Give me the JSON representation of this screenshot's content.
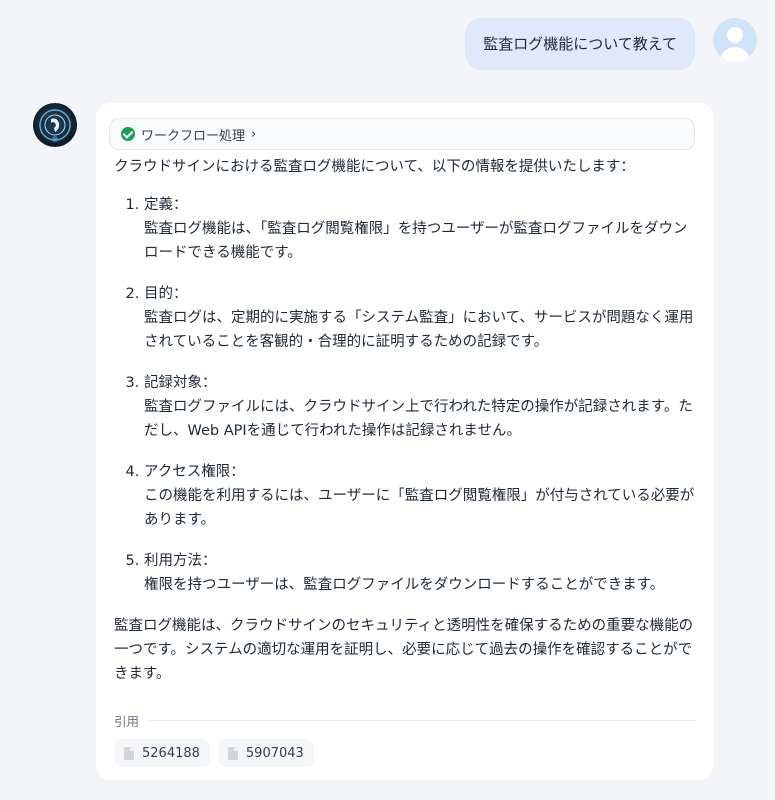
{
  "user_message": {
    "text": "監査ログ機能について教えて"
  },
  "answer": {
    "workflow_label": "ワークフロー処理",
    "intro": "クラウドサインにおける監査ログ機能について、以下の情報を提供いたします：",
    "items": [
      {
        "title": "定義：",
        "body": "監査ログ機能は、「監査ログ閲覧権限」を持つユーザーが監査ログファイルをダウンロードできる機能です。"
      },
      {
        "title": "目的：",
        "body": "監査ログは、定期的に実施する「システム監査」において、サービスが問題なく運用されていることを客観的・合理的に証明するための記録です。"
      },
      {
        "title": "記録対象：",
        "body": "監査ログファイルには、クラウドサイン上で行われた特定の操作が記録されます。ただし、Web APIを通じて行われた操作は記録されません。"
      },
      {
        "title": "アクセス権限：",
        "body": "この機能を利用するには、ユーザーに「監査ログ閲覧権限」が付与されている必要があります。"
      },
      {
        "title": "利用方法：",
        "body": "権限を持つユーザーは、監査ログファイルをダウンロードすることができます。"
      }
    ],
    "summary": "監査ログ機能は、クラウドサインのセキュリティと透明性を確保するための重要な機能の一つです。システムの適切な運用を証明し、必要に応じて過去の操作を確認することができます。",
    "citations_label": "引用",
    "citations": [
      "5264188",
      "5907043"
    ]
  },
  "icons": {
    "workflow_status": "check-circle-icon",
    "workflow_expand": "chevron-right-icon",
    "citation": "document-icon"
  },
  "colors": {
    "accent_green": "#1f9d57",
    "user_bubble": "#dfe9fb"
  }
}
